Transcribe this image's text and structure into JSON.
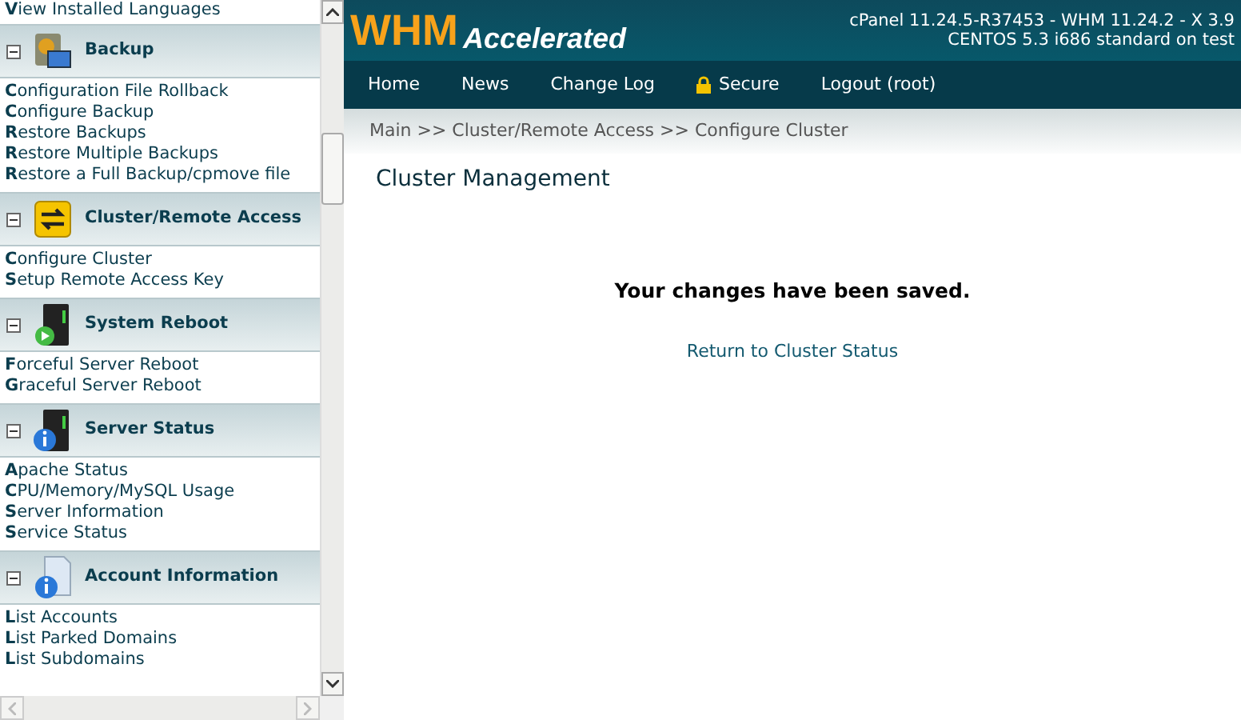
{
  "sidebar": {
    "top_item": "**V**iew Installed Languages",
    "sections": [
      {
        "title": "Backup",
        "kind": "backup",
        "expanded": true,
        "items": [
          "**C**onfiguration File Rollback",
          "**C**onfigure Backup",
          "**R**estore Backups",
          "**R**estore Multiple Backups",
          "**R**estore a Full Backup/cpmove file"
        ]
      },
      {
        "title": "Cluster/Remote Access",
        "kind": "cluster",
        "expanded": true,
        "items": [
          "**C**onfigure Cluster",
          "**S**etup Remote Access Key"
        ]
      },
      {
        "title": "System Reboot",
        "kind": "reboot",
        "expanded": true,
        "items": [
          "**F**orceful Server Reboot",
          "**G**raceful Server Reboot"
        ]
      },
      {
        "title": "Server Status",
        "kind": "server",
        "expanded": true,
        "items": [
          "**A**pache Status",
          "**C**PU/Memory/MySQL Usage",
          "**S**erver Information",
          "**S**ervice Status"
        ]
      },
      {
        "title": "Account Information",
        "kind": "account",
        "expanded": true,
        "items": [
          "**L**ist Accounts",
          "**L**ist Parked Domains",
          "**L**ist Subdomains"
        ]
      }
    ]
  },
  "header": {
    "logo_main": "WHM",
    "logo_sub": "Accelerated",
    "version_lines": [
      "cPanel 11.24.5-R37453 - WHM 11.24.2 - X 3.9",
      "CENTOS 5.3 i686 standard on test"
    ]
  },
  "nav": [
    {
      "label": "Home",
      "kind": "link"
    },
    {
      "label": "News",
      "kind": "link"
    },
    {
      "label": "Change Log",
      "kind": "link"
    },
    {
      "label": "Secure",
      "kind": "secure"
    },
    {
      "label": "Logout (root)",
      "kind": "link"
    }
  ],
  "breadcrumb": "Main >> Cluster/Remote Access >> Configure Cluster",
  "page_title": "Cluster Management",
  "message": "Your changes have been saved.",
  "return_link": "Return to Cluster Status"
}
